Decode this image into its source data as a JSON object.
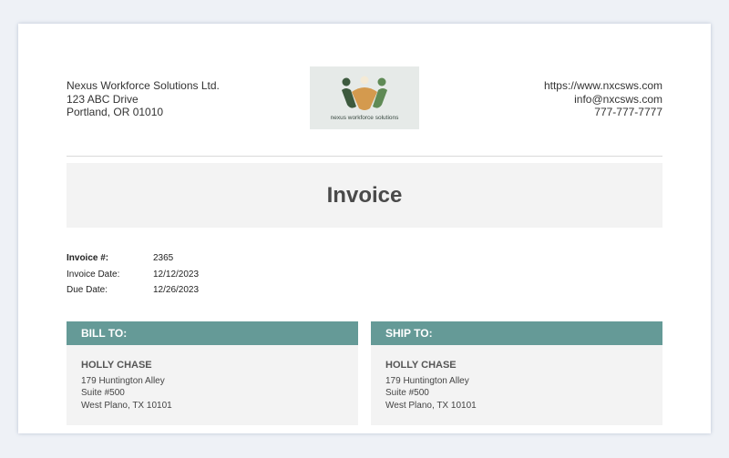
{
  "company": {
    "name": "Nexus Workforce Solutions Ltd.",
    "address_line1": "123 ABC Drive",
    "address_line2": "Portland, OR 01010"
  },
  "contact": {
    "website": "https://www.nxcsws.com",
    "email": "info@nxcsws.com",
    "phone": "777-777-7777"
  },
  "logo": {
    "text": "nexus workforce solutions",
    "colors": [
      "#3d5a3e",
      "#d49a4e",
      "#f4ead6",
      "#5f8a55"
    ]
  },
  "title": "Invoice",
  "meta": [
    {
      "label": "Invoice #:",
      "value": "2365"
    },
    {
      "label": "Invoice Date:",
      "value": "12/12/2023"
    },
    {
      "label": "Due Date:",
      "value": "12/26/2023"
    }
  ],
  "bill_to": {
    "heading": "BILL TO:",
    "name": "HOLLY CHASE",
    "line1": "179 Huntington Alley",
    "line2": "Suite #500",
    "line3": "West Plano, TX 10101"
  },
  "ship_to": {
    "heading": "SHIP TO:",
    "name": "HOLLY CHASE",
    "line1": "179 Huntington Alley",
    "line2": "Suite #500",
    "line3": "West Plano, TX 10101"
  },
  "colors": {
    "accent": "#659a97",
    "panel": "#f3f3f3"
  }
}
